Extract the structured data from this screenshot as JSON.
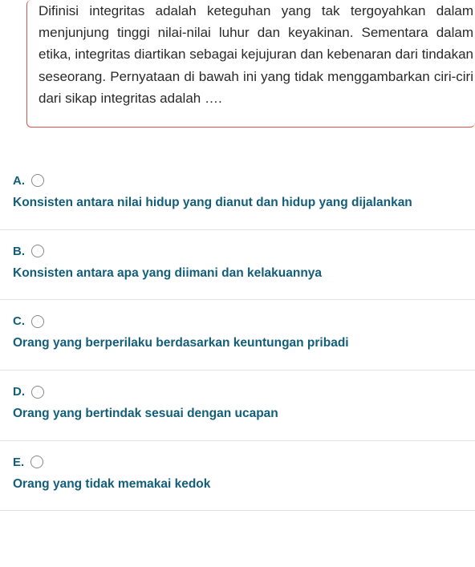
{
  "question": {
    "text": "Difinisi integritas adalah keteguhan yang tak tergoyahkan dalam menjunjung tinggi nilai-nilai luhur dan keyakinan. Sementara dalam etika, integritas diartikan sebagai kejujuran dan kebenaran dari tindakan seseorang. Pernyataan di bawah ini yang tidak menggambarkan ciri-ciri dari sikap integritas adalah …."
  },
  "options": [
    {
      "letter": "A.",
      "text": "Konsisten antara nilai hidup yang dianut dan hidup yang dijalankan"
    },
    {
      "letter": "B.",
      "text": "Konsisten antara apa yang diimani dan kelakuannya"
    },
    {
      "letter": "C.",
      "text": "Orang yang berperilaku berdasarkan keuntungan pribadi"
    },
    {
      "letter": "D.",
      "text": "Orang yang bertindak sesuai dengan ucapan"
    },
    {
      "letter": "E.",
      "text": "Orang yang tidak memakai kedok"
    }
  ]
}
